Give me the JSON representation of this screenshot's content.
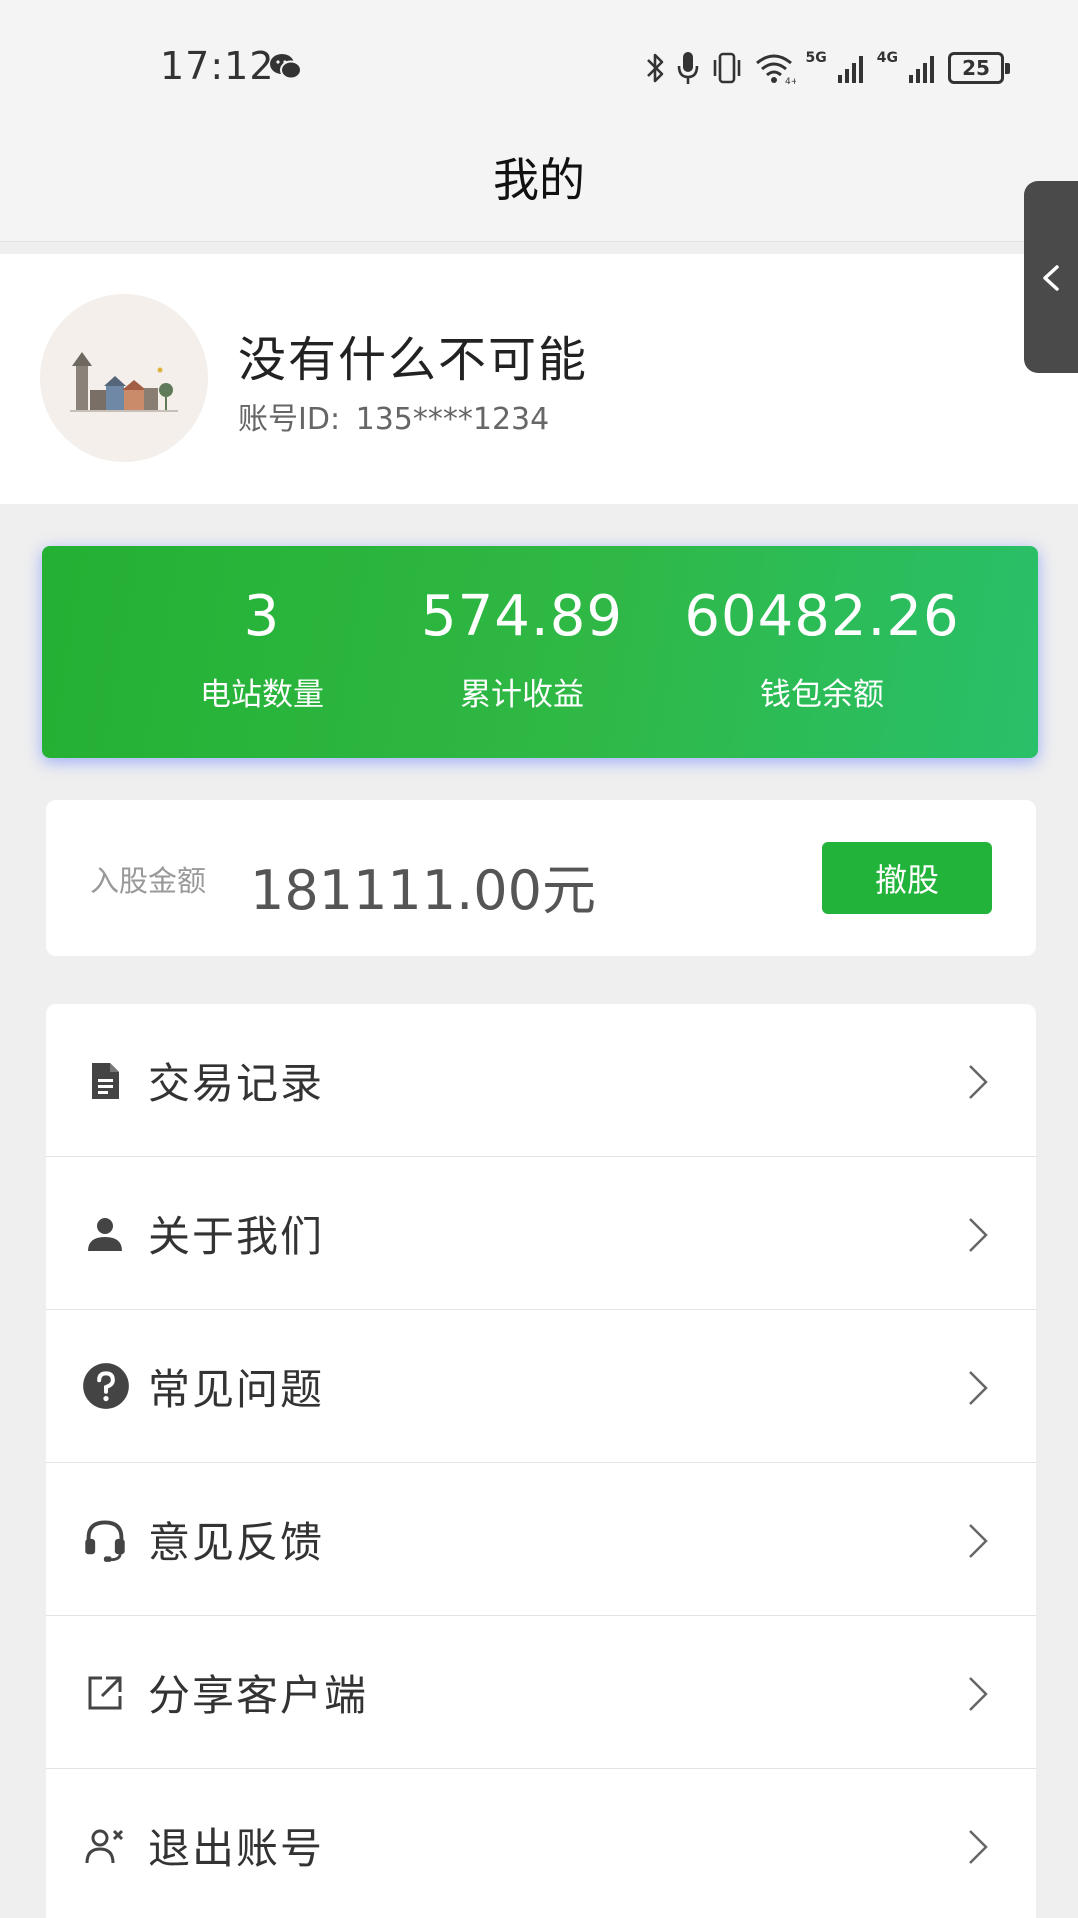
{
  "status_bar": {
    "time": "17:12",
    "battery": "25",
    "network_5g": "5G",
    "network_4g": "4G"
  },
  "header": {
    "title": "我的"
  },
  "profile": {
    "username": "没有什么不可能",
    "account_label": "账号ID:",
    "account_id": "135****1234"
  },
  "stats": [
    {
      "value": "3",
      "label": "电站数量"
    },
    {
      "value": "574.89",
      "label": "累计收益"
    },
    {
      "value": "60482.26",
      "label": "钱包余额"
    }
  ],
  "share": {
    "label": "入股金额",
    "amount": "181111.00元",
    "button_label": "撤股"
  },
  "menu": [
    {
      "label": "交易记录",
      "icon": "document-icon"
    },
    {
      "label": "关于我们",
      "icon": "person-icon"
    },
    {
      "label": "常见问题",
      "icon": "question-icon"
    },
    {
      "label": "意见反馈",
      "icon": "headset-icon"
    },
    {
      "label": "分享客户端",
      "icon": "share-icon"
    },
    {
      "label": "退出账号",
      "icon": "logout-user-icon"
    }
  ],
  "colors": {
    "accent_green": "#22b33a",
    "card_gradient_start": "#24b033",
    "card_gradient_end": "#29c06a"
  }
}
